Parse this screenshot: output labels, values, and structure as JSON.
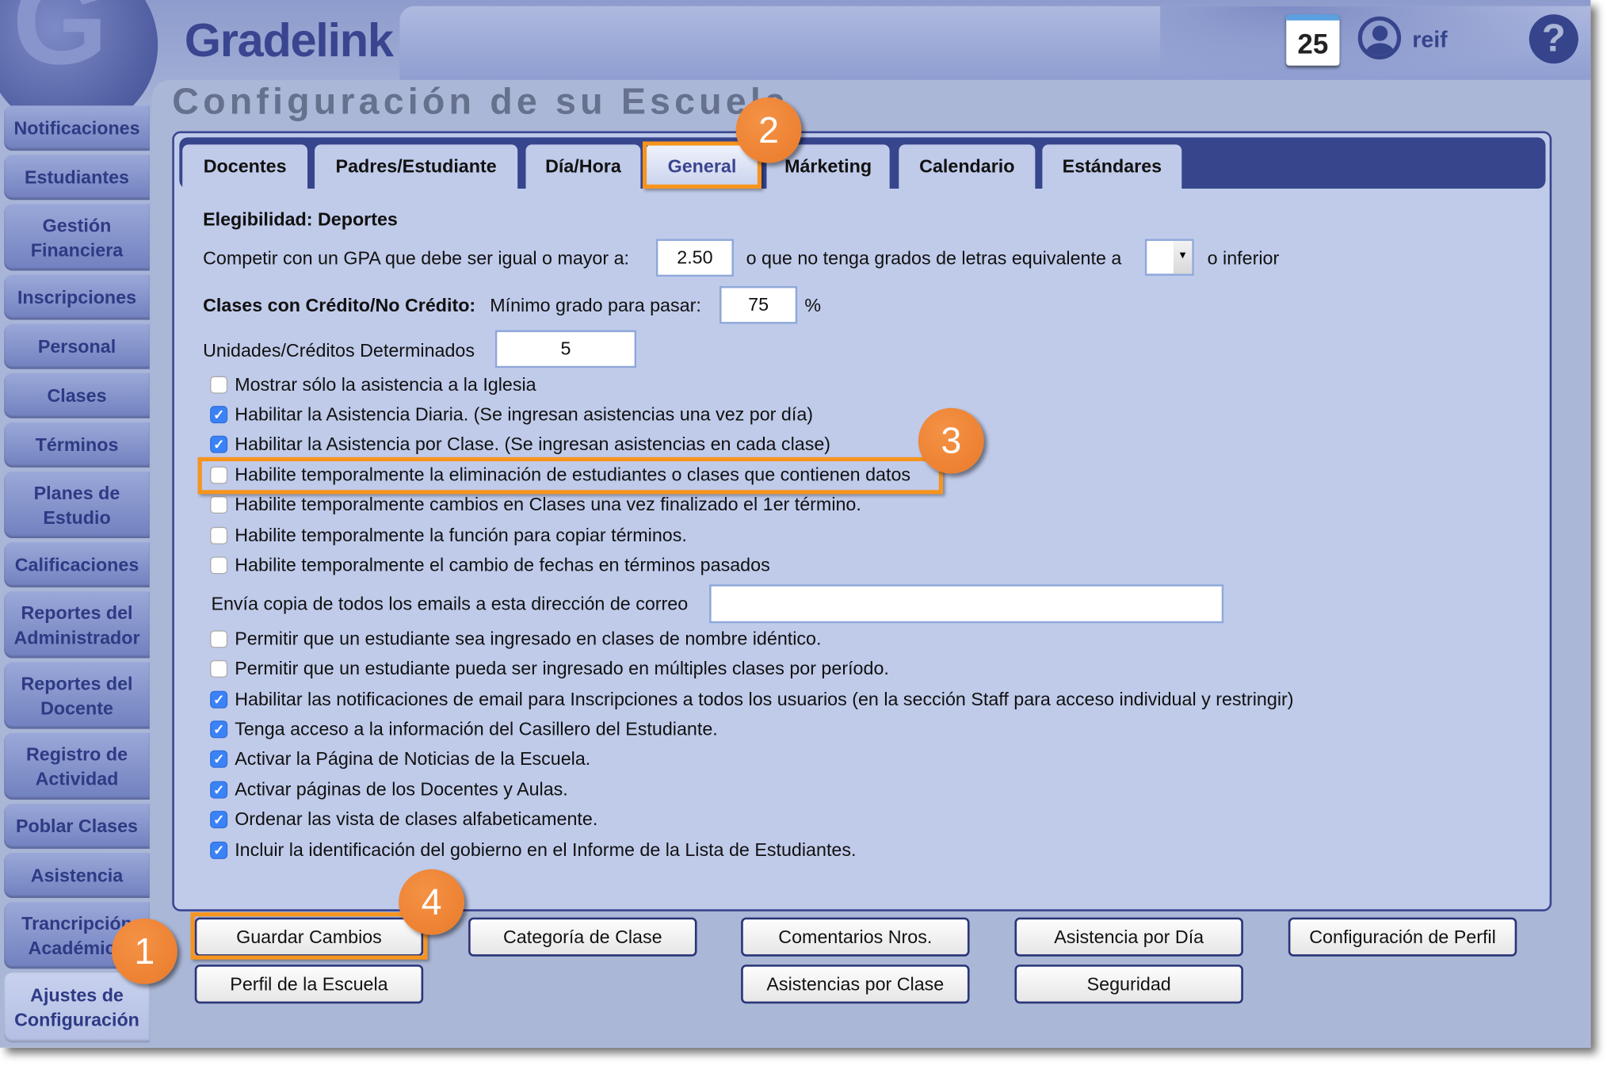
{
  "header": {
    "brand": "Gradelink",
    "calendar_day": "25",
    "user": "reif",
    "help": "?"
  },
  "sidebar": {
    "items": [
      {
        "label": "Notificaciones",
        "h": 44
      },
      {
        "label": "Estudiantes",
        "h": 44
      },
      {
        "label": "Gestión Financiera",
        "h": 65
      },
      {
        "label": "Inscripciones",
        "h": 44
      },
      {
        "label": "Personal",
        "h": 44
      },
      {
        "label": "Clases",
        "h": 44
      },
      {
        "label": "Términos",
        "h": 44
      },
      {
        "label": "Planes de Estudio",
        "h": 65
      },
      {
        "label": "Calificaciones",
        "h": 44
      },
      {
        "label": "Reportes del Administrador",
        "h": 65
      },
      {
        "label": "Reportes del Docente",
        "h": 65
      },
      {
        "label": "Registro de Actividad",
        "h": 65
      },
      {
        "label": "Poblar Clases",
        "h": 44
      },
      {
        "label": "Asistencia",
        "h": 44
      },
      {
        "label": "Trancripción Académica",
        "h": 65
      },
      {
        "label": "Ajustes de Configuración",
        "h": 68,
        "active": true
      }
    ]
  },
  "page_title": "Configuración de su Escuela",
  "tabs": [
    "Docentes",
    "Padres/Estudiante",
    "Día/Hora",
    "General",
    "Márketing",
    "Calendario",
    "Estándares"
  ],
  "active_tab": "General",
  "form": {
    "eligibility_heading": "Elegibilidad: Deportes",
    "gpa_label": "Competir con un GPA que debe ser igual o mayor a:",
    "gpa_value": "2.50",
    "letter_label": "o que no tenga grados de letras equivalente a",
    "letter_value": "",
    "letter_suffix": "o inferior",
    "credit_heading": "Clases con Crédito/No Crédito:",
    "credit_label": "Mínimo grado para pasar:",
    "credit_value": "75",
    "credit_unit": "%",
    "units_label": "Unidades/Créditos Determinados",
    "units_value": "5",
    "email_label": "Envía copia de todos los emails a esta dirección de correo",
    "email_value": "",
    "checkboxes_a": [
      {
        "label": "Mostrar sólo la asistencia a la Iglesia",
        "checked": false
      },
      {
        "label": "Habilitar la Asistencia Diaria. (Se ingresan asistencias una vez por día)",
        "checked": true
      },
      {
        "label": "Habilitar la Asistencia por Clase. (Se ingresan asistencias en cada clase)",
        "checked": true
      },
      {
        "label": "Habilite temporalmente la eliminación de estudiantes o clases que contienen datos",
        "checked": false
      },
      {
        "label": "Habilite temporalmente cambios en Clases una vez finalizado el 1er término.",
        "checked": false
      },
      {
        "label": "Habilite temporalmente la función para copiar términos.",
        "checked": false
      },
      {
        "label": "Habilite temporalmente el cambio de fechas en términos pasados",
        "checked": false
      }
    ],
    "checkboxes_b": [
      {
        "label": "Permitir que un estudiante sea ingresado en clases de nombre idéntico.",
        "checked": false
      },
      {
        "label": "Permitir que un estudiante pueda ser ingresado en múltiples clases por período.",
        "checked": false
      },
      {
        "label": "Habilitar las notificaciones de email para Inscripciones a todos los usuarios (en la sección Staff para acceso individual y restringir)",
        "checked": true
      },
      {
        "label": "Tenga acceso a la información del Casillero del Estudiante.",
        "checked": true
      },
      {
        "label": "Activar la Página de Noticias de la Escuela.",
        "checked": true
      },
      {
        "label": "Activar páginas de los Docentes y Aulas.",
        "checked": true
      },
      {
        "label": "Ordenar las vista de clases alfabeticamente.",
        "checked": true
      },
      {
        "label": "Incluir la identificación del gobierno en el Informe de la Lista de Estudiantes.",
        "checked": true
      }
    ]
  },
  "buttons": {
    "save": "Guardar Cambios",
    "class_category": "Categoría de Clase",
    "comments": "Comentarios Nros.",
    "daily_attendance": "Asistencia por Día",
    "profile_config": "Configuración de Perfil",
    "school_profile": "Perfil de la Escuela",
    "class_attendance": "Asistencias por Clase",
    "security": "Seguridad"
  },
  "annotations": [
    "1",
    "2",
    "3",
    "4"
  ],
  "colors": {
    "accent": "#36458c",
    "annotation": "#f08030",
    "highlight": "#f7941d",
    "checkbox": "#3b82f6"
  }
}
